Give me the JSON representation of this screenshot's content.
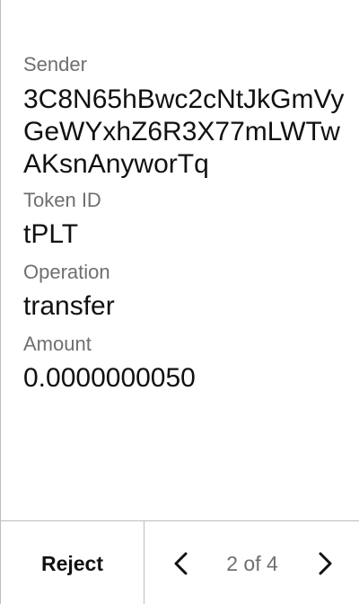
{
  "fields": {
    "sender": {
      "label": "Sender",
      "value": "3C8N65hBwc2cNtJkGmVyGeWYxhZ6R3X77mLWTwAKsnAnyworTq"
    },
    "token_id": {
      "label": "Token ID",
      "value": "tPLT"
    },
    "operation": {
      "label": "Operation",
      "value": "transfer"
    },
    "amount": {
      "label": "Amount",
      "value": "0.0000000050"
    }
  },
  "footer": {
    "reject_label": "Reject",
    "page_indicator": "2 of 4",
    "prev_icon": "chevron-left-icon",
    "next_icon": "chevron-right-icon"
  },
  "colors": {
    "text": "#111111",
    "label": "#6f6f6f",
    "divider": "#bdbdbd",
    "background": "#ffffff"
  }
}
